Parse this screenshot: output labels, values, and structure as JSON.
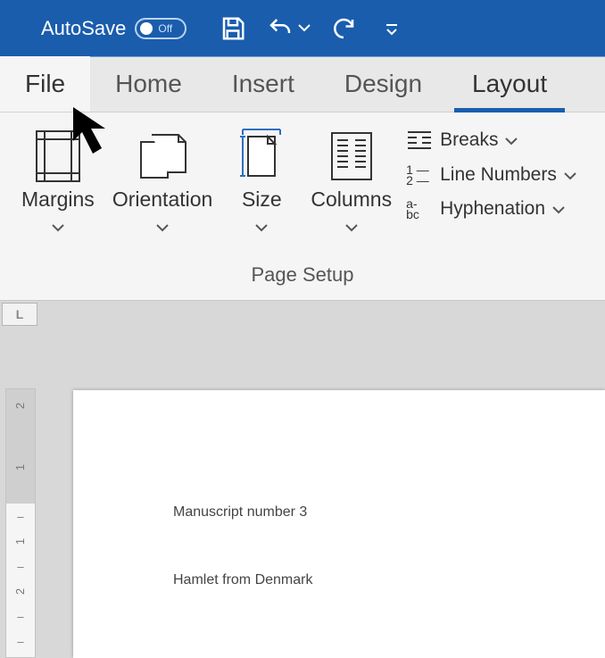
{
  "titlebar": {
    "autosave_label": "AutoSave",
    "autosave_state": "Off"
  },
  "tabs": {
    "file": "File",
    "home": "Home",
    "insert": "Insert",
    "design": "Design",
    "layout": "Layout"
  },
  "ribbon": {
    "margins": "Margins",
    "orientation": "Orientation",
    "size": "Size",
    "columns": "Columns",
    "breaks": "Breaks",
    "line_numbers": "Line Numbers",
    "hyphenation": "Hyphenation",
    "group_label": "Page Setup"
  },
  "ruler": {
    "corner": "L",
    "v": [
      "2",
      "1",
      "",
      "1",
      "",
      "2",
      "",
      ""
    ]
  },
  "document": {
    "line1": "Manuscript number 3",
    "line2": "Hamlet from Denmark"
  }
}
